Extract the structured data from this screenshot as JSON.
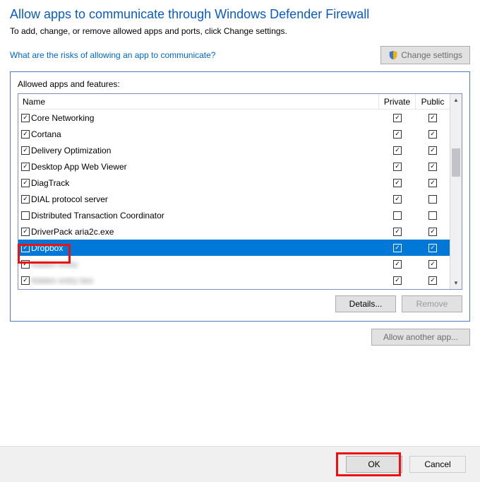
{
  "title": "Allow apps to communicate through Windows Defender Firewall",
  "subtitle": "To add, change, or remove allowed apps and ports, click Change settings.",
  "risk_link": "What are the risks of allowing an app to communicate?",
  "change_settings_label": "Change settings",
  "group_label": "Allowed apps and features:",
  "columns": {
    "name": "Name",
    "private": "Private",
    "public": "Public"
  },
  "rows": [
    {
      "enabled": true,
      "name": "Core Networking",
      "private": true,
      "public": true,
      "selected": false,
      "blurred": false
    },
    {
      "enabled": true,
      "name": "Cortana",
      "private": true,
      "public": true,
      "selected": false,
      "blurred": false
    },
    {
      "enabled": true,
      "name": "Delivery Optimization",
      "private": true,
      "public": true,
      "selected": false,
      "blurred": false
    },
    {
      "enabled": true,
      "name": "Desktop App Web Viewer",
      "private": true,
      "public": true,
      "selected": false,
      "blurred": false
    },
    {
      "enabled": true,
      "name": "DiagTrack",
      "private": true,
      "public": true,
      "selected": false,
      "blurred": false
    },
    {
      "enabled": true,
      "name": "DIAL protocol server",
      "private": true,
      "public": false,
      "selected": false,
      "blurred": false
    },
    {
      "enabled": false,
      "name": "Distributed Transaction Coordinator",
      "private": false,
      "public": false,
      "selected": false,
      "blurred": false
    },
    {
      "enabled": true,
      "name": "DriverPack aria2c.exe",
      "private": true,
      "public": true,
      "selected": false,
      "blurred": false
    },
    {
      "enabled": true,
      "name": "Dropbox",
      "private": true,
      "public": true,
      "selected": true,
      "blurred": false
    },
    {
      "enabled": true,
      "name": "hidden entry",
      "private": true,
      "public": true,
      "selected": false,
      "blurred": true
    },
    {
      "enabled": true,
      "name": "hidden entry two",
      "private": true,
      "public": true,
      "selected": false,
      "blurred": true
    }
  ],
  "buttons": {
    "details": "Details...",
    "remove": "Remove",
    "allow_another": "Allow another app...",
    "ok": "OK",
    "cancel": "Cancel"
  }
}
